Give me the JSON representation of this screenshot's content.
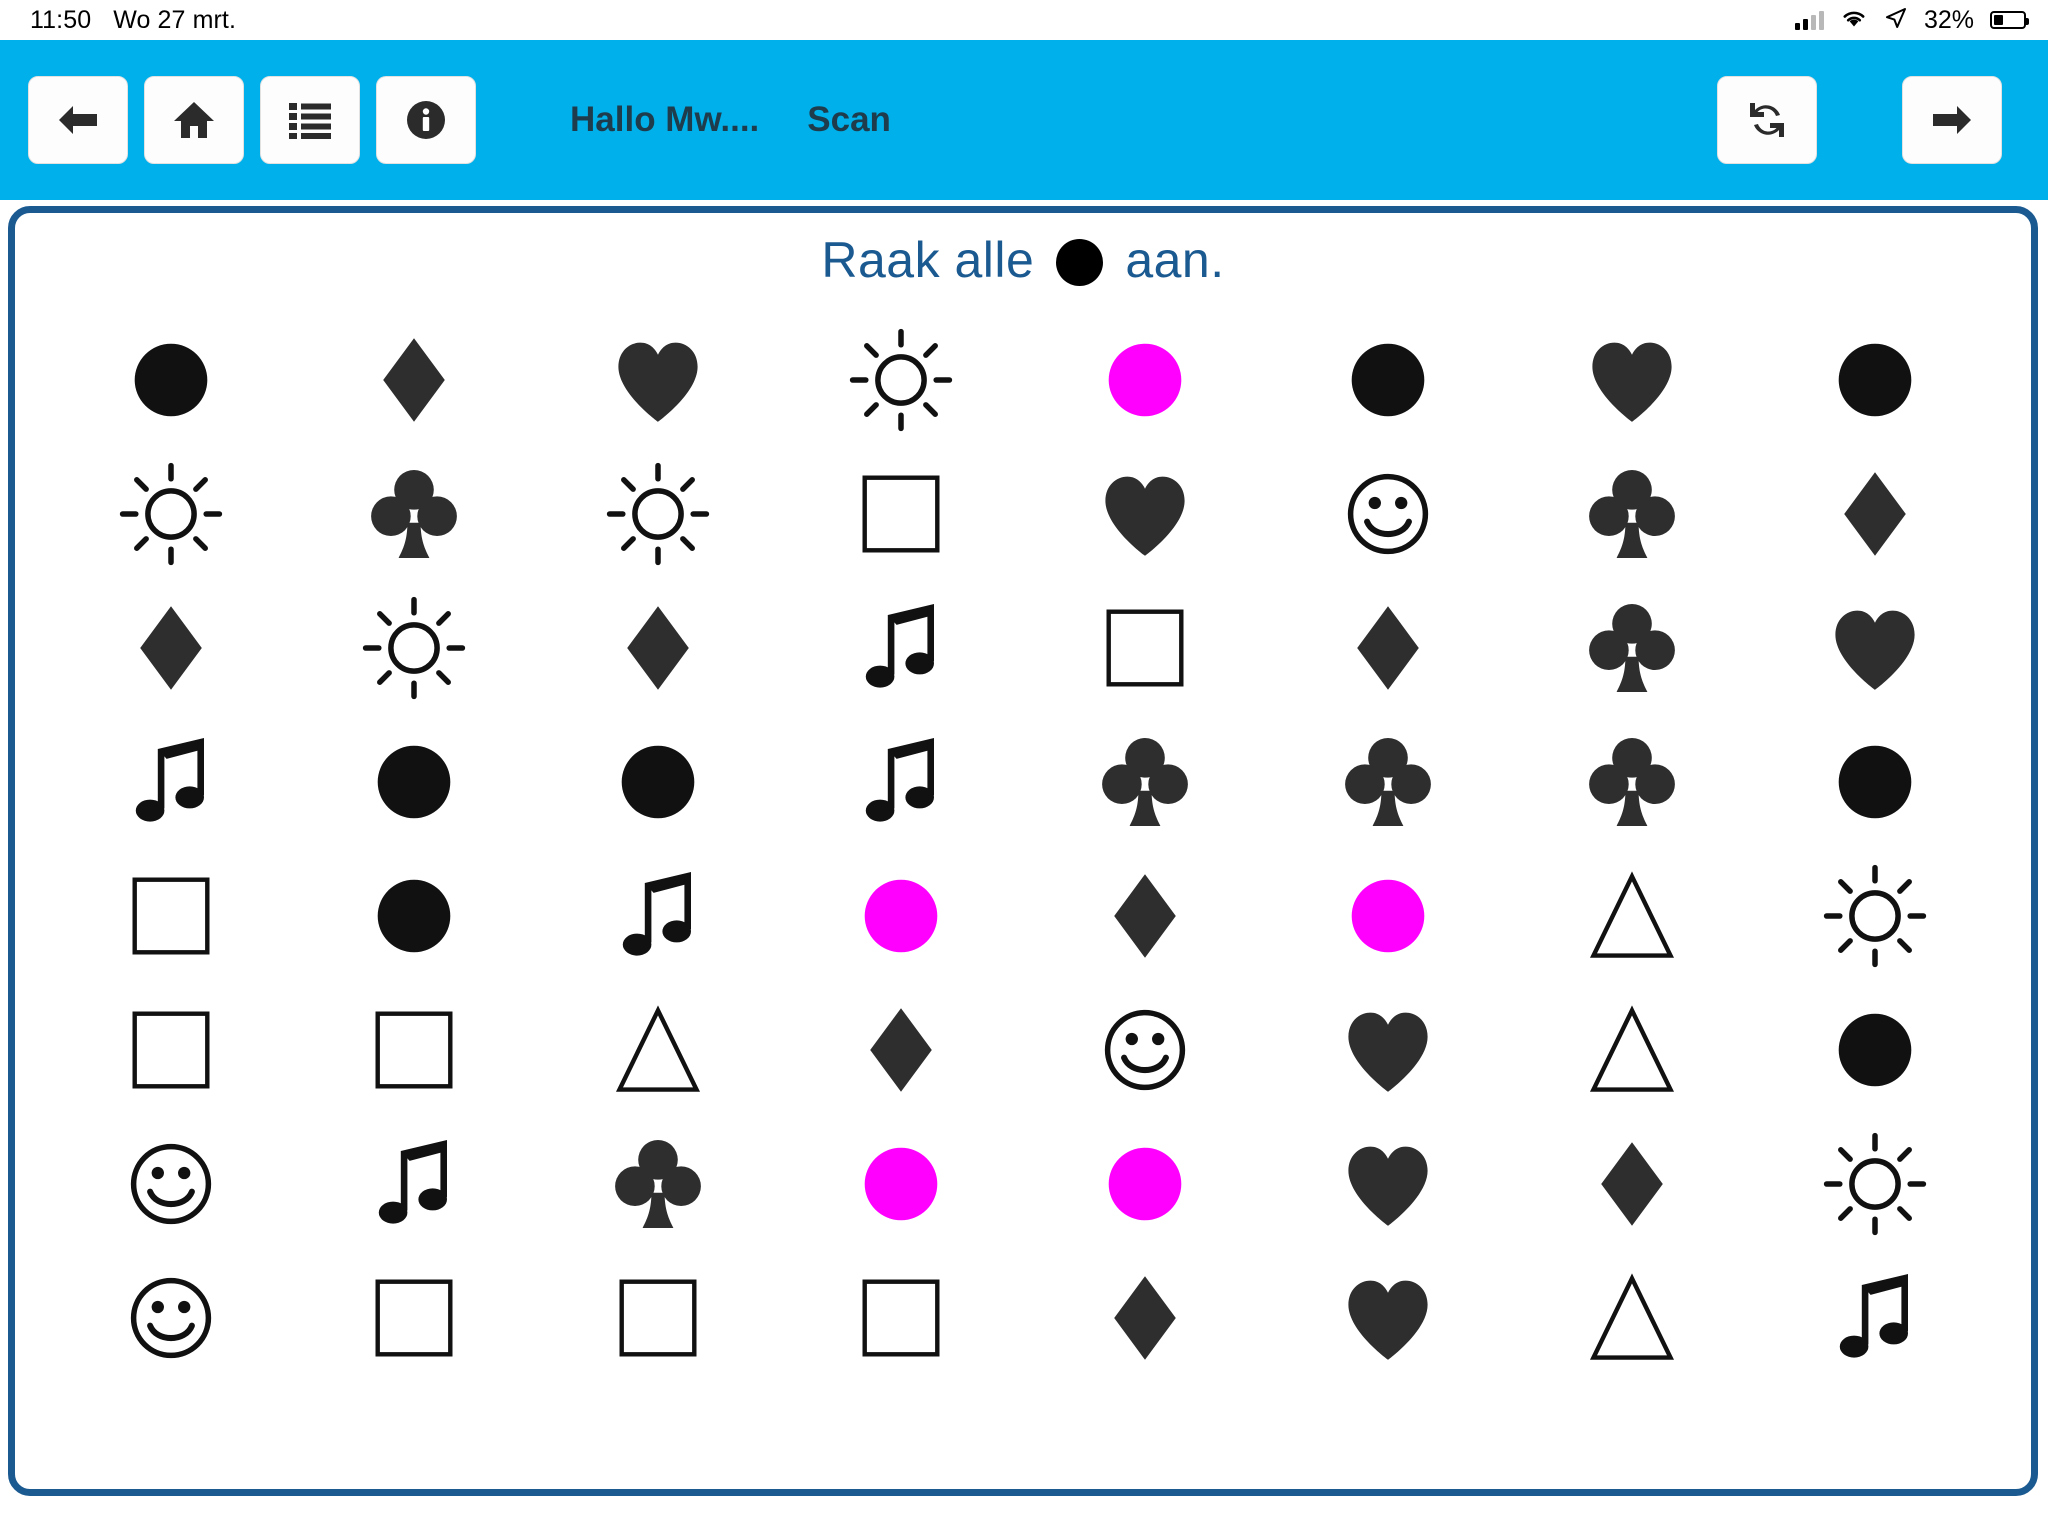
{
  "status_bar": {
    "time": "11:50",
    "date": "Wo 27 mrt.",
    "battery_percent": "32%",
    "icons": [
      "signal-bars-icon",
      "wifi-icon",
      "location-arrow-icon",
      "battery-icon"
    ]
  },
  "toolbar": {
    "background_color": "#00b0ea",
    "back_label": "back-arrow-icon",
    "home_label": "home-icon",
    "list_label": "list-icon",
    "info_label": "info-icon",
    "title": "Hallo Mw....",
    "subtitle": "Scan",
    "refresh_label": "refresh-icon",
    "forward_label": "forward-arrow-icon"
  },
  "content": {
    "border_color": "#1b5a91",
    "prompt_prefix": "Raak alle",
    "prompt_suffix": "aan.",
    "prompt_target_shape": "circle",
    "prompt_target_color": "#000000"
  },
  "colors": {
    "black": "#111111",
    "dark": "#2e2e2e",
    "magenta": "#ff00ff",
    "outline": "#111111",
    "accent_blue": "#1b5a91",
    "header_cyan": "#00b0ea"
  },
  "chart_data": {
    "type": "table",
    "title": "Raak alle ● aan.",
    "rows": 8,
    "columns": 8,
    "legend": [
      "circle",
      "diamond",
      "heart",
      "sun",
      "club",
      "square",
      "music",
      "smiley",
      "triangle"
    ],
    "grid": [
      [
        {
          "shape": "circle",
          "color": "#111111",
          "filled": true
        },
        {
          "shape": "diamond",
          "color": "#2e2e2e",
          "filled": true
        },
        {
          "shape": "heart",
          "color": "#2e2e2e",
          "filled": true
        },
        {
          "shape": "sun",
          "color": "#111111",
          "filled": false
        },
        {
          "shape": "circle",
          "color": "#ff00ff",
          "filled": true
        },
        {
          "shape": "circle",
          "color": "#111111",
          "filled": true
        },
        {
          "shape": "heart",
          "color": "#2e2e2e",
          "filled": true
        },
        {
          "shape": "circle",
          "color": "#111111",
          "filled": true
        }
      ],
      [
        {
          "shape": "sun",
          "color": "#111111",
          "filled": false
        },
        {
          "shape": "club",
          "color": "#2e2e2e",
          "filled": true
        },
        {
          "shape": "sun",
          "color": "#111111",
          "filled": false
        },
        {
          "shape": "square",
          "color": "#111111",
          "filled": false
        },
        {
          "shape": "heart",
          "color": "#2e2e2e",
          "filled": true
        },
        {
          "shape": "smiley",
          "color": "#111111",
          "filled": false
        },
        {
          "shape": "club",
          "color": "#2e2e2e",
          "filled": true
        },
        {
          "shape": "diamond",
          "color": "#2e2e2e",
          "filled": true
        }
      ],
      [
        {
          "shape": "diamond",
          "color": "#2e2e2e",
          "filled": true
        },
        {
          "shape": "sun",
          "color": "#111111",
          "filled": false
        },
        {
          "shape": "diamond",
          "color": "#2e2e2e",
          "filled": true
        },
        {
          "shape": "music",
          "color": "#111111",
          "filled": true
        },
        {
          "shape": "square",
          "color": "#111111",
          "filled": false
        },
        {
          "shape": "diamond",
          "color": "#2e2e2e",
          "filled": true
        },
        {
          "shape": "club",
          "color": "#2e2e2e",
          "filled": true
        },
        {
          "shape": "heart",
          "color": "#2e2e2e",
          "filled": true
        }
      ],
      [
        {
          "shape": "music",
          "color": "#111111",
          "filled": true
        },
        {
          "shape": "circle",
          "color": "#111111",
          "filled": true
        },
        {
          "shape": "circle",
          "color": "#111111",
          "filled": true
        },
        {
          "shape": "music",
          "color": "#111111",
          "filled": true
        },
        {
          "shape": "club",
          "color": "#2e2e2e",
          "filled": true
        },
        {
          "shape": "club",
          "color": "#2e2e2e",
          "filled": true
        },
        {
          "shape": "club",
          "color": "#2e2e2e",
          "filled": true
        },
        {
          "shape": "circle",
          "color": "#111111",
          "filled": true
        }
      ],
      [
        {
          "shape": "square",
          "color": "#111111",
          "filled": false
        },
        {
          "shape": "circle",
          "color": "#111111",
          "filled": true
        },
        {
          "shape": "music",
          "color": "#111111",
          "filled": true
        },
        {
          "shape": "circle",
          "color": "#ff00ff",
          "filled": true
        },
        {
          "shape": "diamond",
          "color": "#2e2e2e",
          "filled": true
        },
        {
          "shape": "circle",
          "color": "#ff00ff",
          "filled": true
        },
        {
          "shape": "triangle",
          "color": "#111111",
          "filled": false
        },
        {
          "shape": "sun",
          "color": "#111111",
          "filled": false
        }
      ],
      [
        {
          "shape": "square",
          "color": "#111111",
          "filled": false
        },
        {
          "shape": "square",
          "color": "#111111",
          "filled": false
        },
        {
          "shape": "triangle",
          "color": "#111111",
          "filled": false
        },
        {
          "shape": "diamond",
          "color": "#2e2e2e",
          "filled": true
        },
        {
          "shape": "smiley",
          "color": "#111111",
          "filled": false
        },
        {
          "shape": "heart",
          "color": "#2e2e2e",
          "filled": true
        },
        {
          "shape": "triangle",
          "color": "#111111",
          "filled": false
        },
        {
          "shape": "circle",
          "color": "#111111",
          "filled": true
        }
      ],
      [
        {
          "shape": "smiley",
          "color": "#111111",
          "filled": false
        },
        {
          "shape": "music",
          "color": "#111111",
          "filled": true
        },
        {
          "shape": "club",
          "color": "#2e2e2e",
          "filled": true
        },
        {
          "shape": "circle",
          "color": "#ff00ff",
          "filled": true
        },
        {
          "shape": "circle",
          "color": "#ff00ff",
          "filled": true
        },
        {
          "shape": "heart",
          "color": "#2e2e2e",
          "filled": true
        },
        {
          "shape": "diamond",
          "color": "#2e2e2e",
          "filled": true
        },
        {
          "shape": "sun",
          "color": "#111111",
          "filled": false
        }
      ],
      [
        {
          "shape": "smiley",
          "color": "#111111",
          "filled": false
        },
        {
          "shape": "square",
          "color": "#111111",
          "filled": false
        },
        {
          "shape": "square",
          "color": "#111111",
          "filled": false
        },
        {
          "shape": "square",
          "color": "#111111",
          "filled": false
        },
        {
          "shape": "diamond",
          "color": "#2e2e2e",
          "filled": true
        },
        {
          "shape": "heart",
          "color": "#2e2e2e",
          "filled": true
        },
        {
          "shape": "triangle",
          "color": "#111111",
          "filled": false
        },
        {
          "shape": "music",
          "color": "#111111",
          "filled": true
        }
      ]
    ]
  }
}
